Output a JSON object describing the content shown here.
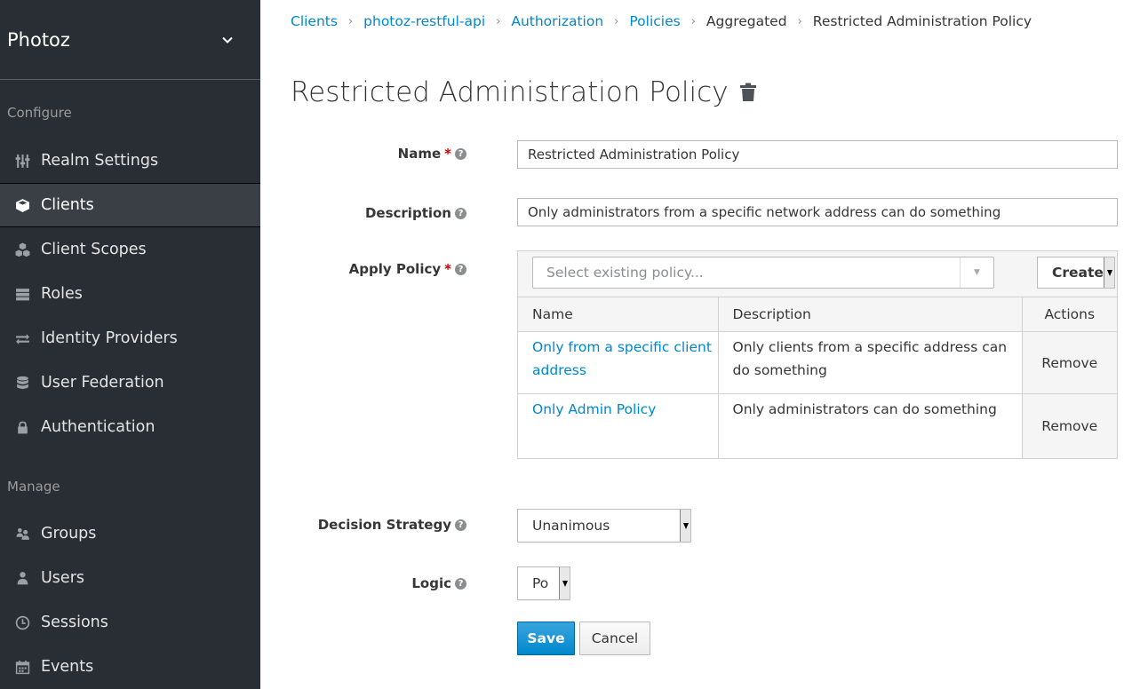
{
  "sidebar": {
    "realm": "Photoz",
    "configure_title": "Configure",
    "manage_title": "Manage",
    "configure_items": [
      {
        "label": "Realm Settings",
        "icon": "sliders-icon"
      },
      {
        "label": "Clients",
        "icon": "cube-icon"
      },
      {
        "label": "Client Scopes",
        "icon": "cubes-icon"
      },
      {
        "label": "Roles",
        "icon": "list-icon"
      },
      {
        "label": "Identity Providers",
        "icon": "exchange-icon"
      },
      {
        "label": "User Federation",
        "icon": "database-icon"
      },
      {
        "label": "Authentication",
        "icon": "lock-icon"
      }
    ],
    "manage_items": [
      {
        "label": "Groups",
        "icon": "users-icon"
      },
      {
        "label": "Users",
        "icon": "user-icon"
      },
      {
        "label": "Sessions",
        "icon": "clock-icon"
      },
      {
        "label": "Events",
        "icon": "calendar-icon"
      }
    ],
    "active": "Clients"
  },
  "breadcrumb": {
    "items": [
      "Clients",
      "photoz-restful-api",
      "Authorization",
      "Policies",
      "Aggregated",
      "Restricted Administration Policy"
    ]
  },
  "page_title": "Restricted Administration Policy",
  "form": {
    "name_label": "Name",
    "name_value": "Restricted Administration Policy",
    "description_label": "Description",
    "description_value": "Only administrators from a specific network address can do something",
    "apply_policy_label": "Apply Policy",
    "select_placeholder": "Select existing policy...",
    "create_label": "Create",
    "table": {
      "headers": [
        "Name",
        "Description",
        "Actions"
      ],
      "rows": [
        {
          "name": "Only from a specific client address",
          "description": "Only clients from a specific address can do something",
          "action": "Remove"
        },
        {
          "name": "Only Admin Policy",
          "description": "Only administrators can do something",
          "action": "Remove"
        }
      ]
    },
    "decision_strategy_label": "Decision Strategy",
    "decision_strategy_value": "Unanimous",
    "logic_label": "Logic",
    "logic_value": "Po",
    "required_mark": "*",
    "help_mark": "?",
    "save_label": "Save",
    "cancel_label": "Cancel"
  }
}
